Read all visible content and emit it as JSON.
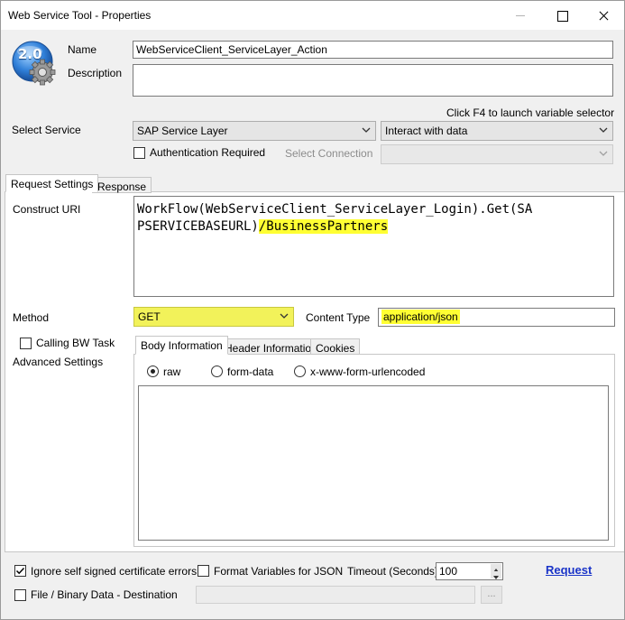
{
  "window": {
    "title": "Web Service Tool - Properties"
  },
  "badge": {
    "version": "2.0"
  },
  "name": {
    "label": "Name",
    "value": "WebServiceClient_ServiceLayer_Action"
  },
  "description": {
    "label": "Description",
    "value": ""
  },
  "hint": "Click F4 to launch variable selector",
  "service": {
    "label": "Select Service",
    "value": "SAP Service Layer",
    "interact_value": "Interact with data",
    "auth_label": "Authentication Required",
    "select_connection_label": "Select Connection",
    "connection_value": ""
  },
  "main_tabs": [
    {
      "label": "Request Settings"
    },
    {
      "label": "Response"
    }
  ],
  "uri": {
    "label": "Construct URI",
    "line1": "WorkFlow(WebServiceClient_ServiceLayer_Login).Get(SA",
    "line2_plain": "PSERVICEBASEURL)",
    "line2_highlight": "/BusinessPartners"
  },
  "method": {
    "label": "Method",
    "value": "GET"
  },
  "content_type": {
    "label": "Content Type",
    "value": "application/json"
  },
  "calling_bw": {
    "label": "Calling BW Task"
  },
  "advanced_settings": {
    "label": "Advanced Settings"
  },
  "sub_tabs": [
    {
      "label": "Body Information"
    },
    {
      "label": "Header Information"
    },
    {
      "label": "Cookies"
    }
  ],
  "body_modes": [
    {
      "label": "raw",
      "checked": true
    },
    {
      "label": "form-data"
    },
    {
      "label": "x-www-form-urlencoded"
    }
  ],
  "footer": {
    "ignore_ssl_label": "Ignore self signed certificate errors",
    "format_vars_label": "Format Variables for JSON",
    "timeout_label": "Timeout (Seconds)",
    "timeout_value": "100",
    "request_label": "Request",
    "file_label": "File / Binary Data - Destination",
    "browse_label": "...",
    "file_value": ""
  },
  "icons": {
    "minimize": "minimize-icon",
    "maximize": "maximize-icon",
    "close": "close-icon",
    "gear": "gear-icon",
    "dropdown": "chevron-down-icon",
    "check": "check-icon",
    "spin_up": "spin-up-icon",
    "spin_down": "spin-down-icon"
  },
  "colors": {
    "highlight": "#ffff33",
    "link": "#1a34c8",
    "badge_blue": "#2f7fd8"
  }
}
